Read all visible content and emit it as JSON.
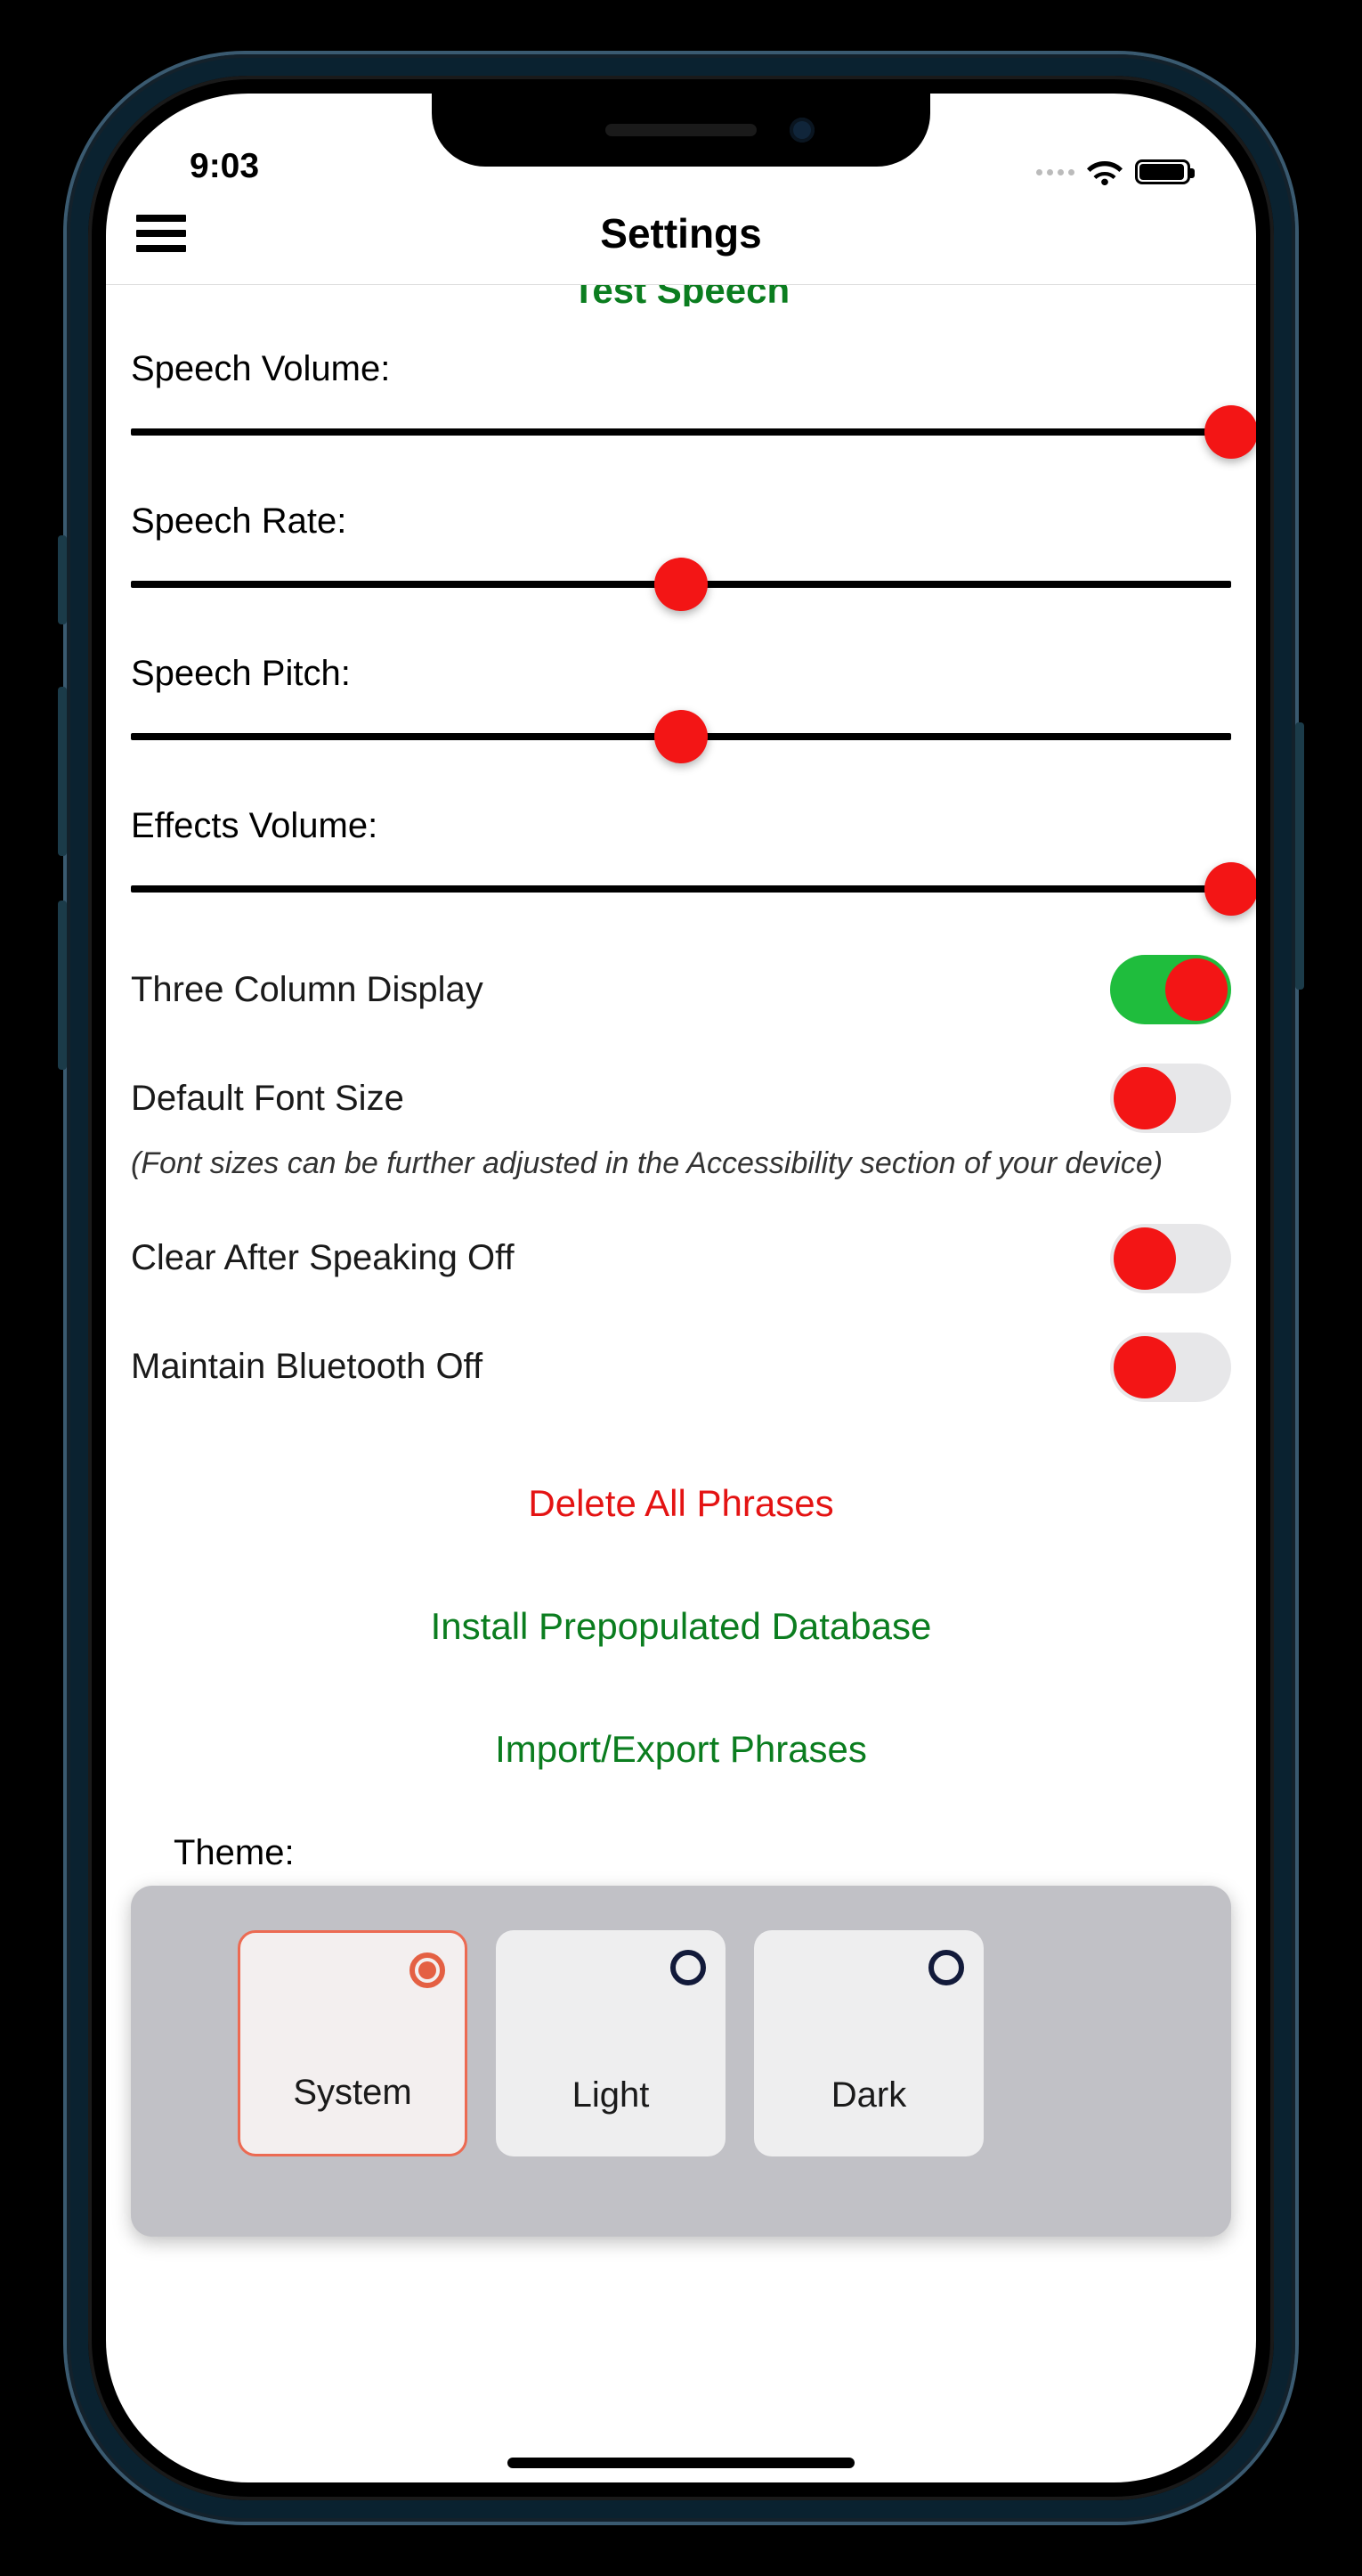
{
  "status": {
    "time": "9:03"
  },
  "header": {
    "title": "Settings"
  },
  "peek_button": "Test Speech",
  "sliders": {
    "speech_volume": {
      "label": "Speech Volume:",
      "value": 100
    },
    "speech_rate": {
      "label": "Speech Rate:",
      "value": 50
    },
    "speech_pitch": {
      "label": "Speech Pitch:",
      "value": 50
    },
    "effects_volume": {
      "label": "Effects Volume:",
      "value": 100
    }
  },
  "toggles": {
    "three_column": {
      "label": "Three Column Display",
      "on": true,
      "style": "green"
    },
    "default_font": {
      "label": "Default Font Size",
      "on": false,
      "style": "gray"
    },
    "clear_after": {
      "label": "Clear After Speaking Off",
      "on": false,
      "style": "gray"
    },
    "bluetooth": {
      "label": "Maintain Bluetooth Off",
      "on": false,
      "style": "gray"
    }
  },
  "font_hint": "(Font sizes can be further adjusted in the Accessibility section of your device)",
  "actions": {
    "delete_all": "Delete All Phrases",
    "install_db": "Install Prepopulated Database",
    "import_export": "Import/Export Phrases"
  },
  "theme": {
    "label": "Theme:",
    "options": [
      "System",
      "Light",
      "Dark"
    ],
    "selected": "System"
  }
}
